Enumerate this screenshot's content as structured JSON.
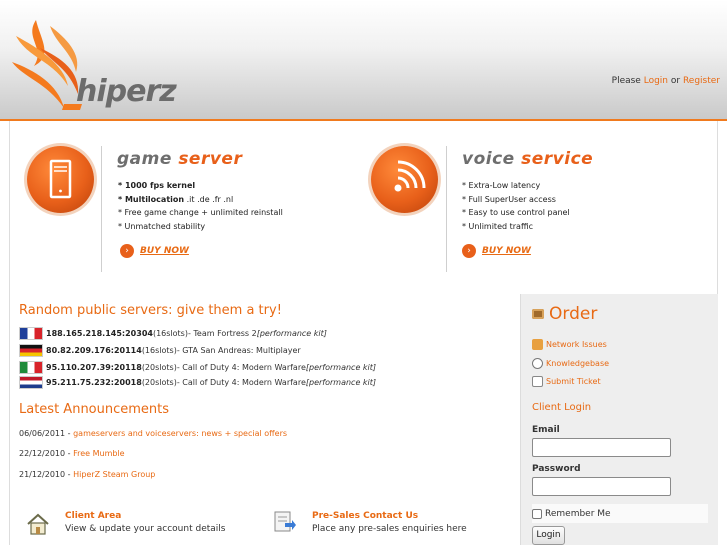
{
  "header": {
    "logo_text": "hiperz",
    "login_prefix": "Please ",
    "login_link": "Login",
    "login_or": " or ",
    "register_link": "Register"
  },
  "features": [
    {
      "title_part1": "game",
      "title_part2": "server",
      "icon": "server-tower-icon",
      "bullets": [
        {
          "bold": "* 1000 fps kernel",
          "rest": ""
        },
        {
          "bold": "* Multilocation",
          "rest": " .it .de .fr .nl"
        },
        {
          "bold": "* Free game change + unlimited reinstall",
          "rest": ""
        },
        {
          "bold": "* Unmatched stability",
          "rest": ""
        }
      ],
      "buy_label": "BUY NOW"
    },
    {
      "title_part1": "voice",
      "title_part2": "service",
      "icon": "broadcast-icon",
      "bullets": [
        {
          "bold": "* Extra-Low latency",
          "rest": ""
        },
        {
          "bold": "* Full SuperUser access",
          "rest": ""
        },
        {
          "bold": "* Easy to use control panel",
          "rest": ""
        },
        {
          "bold": "* Unlimited traffic",
          "rest": ""
        }
      ],
      "buy_label": "BUY NOW"
    }
  ],
  "servers": {
    "title": "Random public servers: give them a try!",
    "items": [
      {
        "flag": "fr",
        "address": "188.165.218.145:20304",
        "slots": " (16slots)",
        "game": " - Team Fortress 2 ",
        "kit": "[performance kit]"
      },
      {
        "flag": "de",
        "address": "80.82.209.176:20114",
        "slots": " (16slots)",
        "game": " - GTA San Andreas: Multiplayer",
        "kit": ""
      },
      {
        "flag": "it",
        "address": "95.110.207.39:20118",
        "slots": " (20slots)",
        "game": " - Call of Duty 4: Modern Warfare ",
        "kit": "[performance kit]"
      },
      {
        "flag": "nl",
        "address": "95.211.75.232:20018",
        "slots": " (20slots)",
        "game": " - Call of Duty 4: Modern Warfare ",
        "kit": "[performance kit]"
      }
    ]
  },
  "announcements": {
    "title": "Latest Announcements",
    "items": [
      {
        "date": "06/06/2011 - ",
        "text": "gameservers and voiceservers: news + special offers"
      },
      {
        "date": "22/12/2010 - ",
        "text": "Free Mumble"
      },
      {
        "date": "21/12/2010 - ",
        "text": "HiperZ Steam Group"
      }
    ]
  },
  "bottom_links": [
    {
      "title": "Client Area",
      "desc": "View & update your account details",
      "icon": "house-icon"
    },
    {
      "title": "Pre-Sales Contact Us",
      "desc": "Place any pre-sales enquiries here",
      "icon": "form-arrow-icon"
    }
  ],
  "sidebar": {
    "order_title": "Order",
    "links": [
      {
        "label": "Network Issues",
        "icon": "network-icon"
      },
      {
        "label": "Knowledgebase",
        "icon": "magnifier-icon"
      },
      {
        "label": "Submit Ticket",
        "icon": "ticket-icon"
      }
    ],
    "client_login_title": "Client Login",
    "email_label": "Email",
    "password_label": "Password",
    "remember_label": "Remember Me",
    "login_button": "Login"
  },
  "colors": {
    "accent": "#e86a14",
    "header_line": "#f07a1e"
  }
}
